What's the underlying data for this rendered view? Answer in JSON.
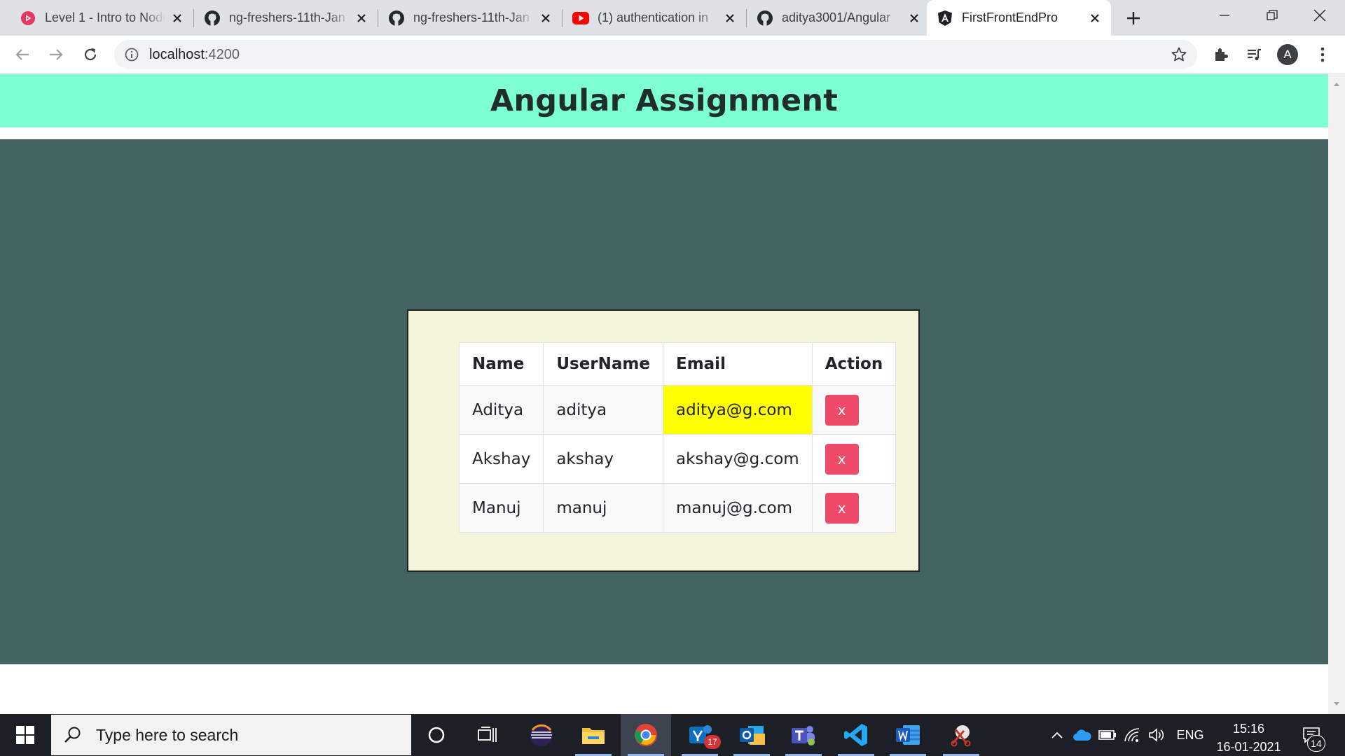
{
  "browser": {
    "tabs": [
      {
        "title": "Level 1 - Intro to Node",
        "icon": "youtube-red-play-icon"
      },
      {
        "title": "ng-freshers-11th-Jan",
        "icon": "github-icon"
      },
      {
        "title": "ng-freshers-11th-Jan",
        "icon": "github-icon"
      },
      {
        "title": "(1) authentication in",
        "icon": "youtube-icon"
      },
      {
        "title": "aditya3001/Angular",
        "icon": "github-icon"
      },
      {
        "title": "FirstFrontEndPro",
        "icon": "angular-icon",
        "active": true
      }
    ],
    "url_host": "localhost",
    "url_port": ":4200",
    "profile_initial": "A"
  },
  "app": {
    "title": "Angular Assignment",
    "header_color": "#7fffd4",
    "background_color": "#436262",
    "card_color": "#f5f5dc",
    "highlight_color": "#ffff00",
    "button_color": "#ee4b6a"
  },
  "table": {
    "headers": [
      "Name",
      "UserName",
      "Email",
      "Action"
    ],
    "rows": [
      {
        "name": "Aditya",
        "username": "aditya",
        "email": "aditya@g.com",
        "action": "x",
        "highlighted": true
      },
      {
        "name": "Akshay",
        "username": "akshay",
        "email": "akshay@g.com",
        "action": "x",
        "highlighted": false
      },
      {
        "name": "Manuj",
        "username": "manuj",
        "email": "manuj@g.com",
        "action": "x",
        "highlighted": false
      }
    ]
  },
  "taskbar": {
    "search_placeholder": "Type here to search",
    "language": "ENG",
    "time": "15:16",
    "date": "16-01-2021",
    "notification_count": "14",
    "yammer_badge": "17"
  }
}
